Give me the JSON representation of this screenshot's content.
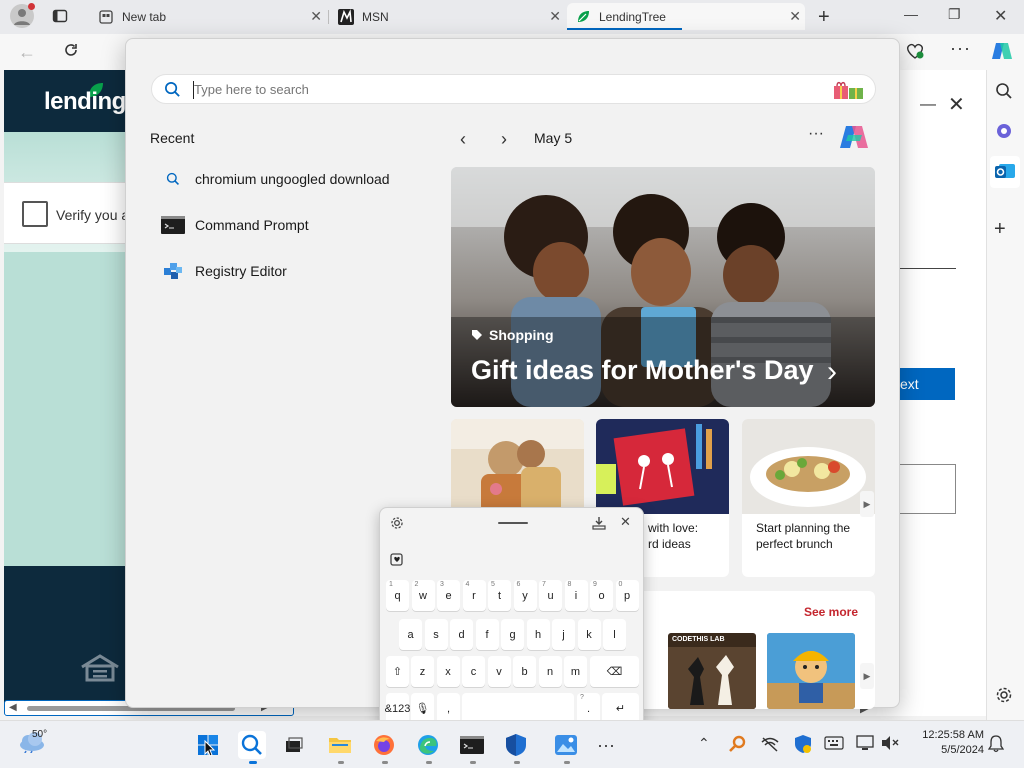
{
  "tabs": [
    {
      "label": "New tab"
    },
    {
      "label": "MSN"
    },
    {
      "label": "LendingTree"
    }
  ],
  "page": {
    "brand": "lendingt",
    "verify_label": "Verify you a",
    "next_label": "ext"
  },
  "search": {
    "placeholder": "Type here to search"
  },
  "recent": {
    "heading": "Recent",
    "items": [
      {
        "label": "chromium ungoogled download",
        "icon": "search-icon"
      },
      {
        "label": "Command Prompt",
        "icon": "cmd-icon"
      },
      {
        "label": "Registry Editor",
        "icon": "registry-icon"
      }
    ]
  },
  "feed": {
    "date": "May 5",
    "hero": {
      "category": "Shopping",
      "title": "Gift ideas for Mother's Day"
    },
    "cards": [
      {
        "caption": ""
      },
      {
        "caption_line1": "with love:",
        "caption_line2": "rd ideas"
      },
      {
        "caption_line1": "Start planning the",
        "caption_line2": "perfect brunch"
      }
    ],
    "see_more": "See more",
    "game_label": "CODETHIS LAB"
  },
  "keyboard": {
    "row1": [
      {
        "k": "q",
        "n": "1"
      },
      {
        "k": "w",
        "n": "2"
      },
      {
        "k": "e",
        "n": "3"
      },
      {
        "k": "r",
        "n": "4"
      },
      {
        "k": "t",
        "n": "5"
      },
      {
        "k": "y",
        "n": "6"
      },
      {
        "k": "u",
        "n": "7"
      },
      {
        "k": "i",
        "n": "8"
      },
      {
        "k": "o",
        "n": "9"
      },
      {
        "k": "p",
        "n": "0"
      }
    ],
    "row2": [
      "a",
      "s",
      "d",
      "f",
      "g",
      "h",
      "j",
      "k",
      "l"
    ],
    "row3": [
      "z",
      "x",
      "c",
      "v",
      "b",
      "n",
      "m"
    ],
    "sym_label": "&123",
    "comma": ",",
    "period": ".",
    "question": "?"
  },
  "taskbar": {
    "weather": "50°",
    "time": "12:25:58 AM",
    "date": "5/5/2024"
  },
  "colors": {
    "accent": "#0067c0",
    "lt_navy": "#0d2a3d",
    "lt_teal": "#b9dfd6",
    "see_more": "#c4262e"
  }
}
